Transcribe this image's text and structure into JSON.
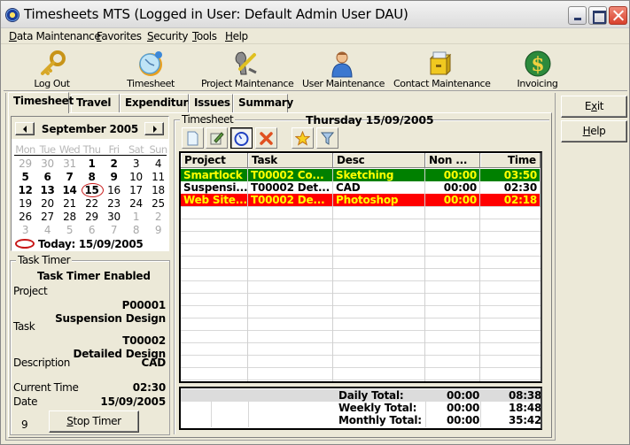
{
  "window": {
    "title": "Timesheets MTS (Logged in User: Default Admin User DAU)",
    "controls": [
      "minimize",
      "maximize",
      "close"
    ]
  },
  "menu": [
    {
      "label": "Data Maintenance",
      "accel": "D"
    },
    {
      "label": "Favorites",
      "accel": "F"
    },
    {
      "label": "Security",
      "accel": "S"
    },
    {
      "label": "Tools",
      "accel": "T"
    },
    {
      "label": "Help",
      "accel": "H"
    }
  ],
  "toolbar": [
    {
      "label": "Log Out",
      "icon": "key-icon"
    },
    {
      "label": "Timesheet",
      "icon": "clock-icon"
    },
    {
      "label": "Project Maintenance",
      "icon": "tools-icon"
    },
    {
      "label": "User Maintenance",
      "icon": "user-icon"
    },
    {
      "label": "Contact Maintenance",
      "icon": "filing-cabinet-icon"
    },
    {
      "label": "Invoicing",
      "icon": "dollar-icon"
    }
  ],
  "tabs": [
    {
      "label": "Timesheet",
      "active": true
    },
    {
      "label": "Travel",
      "active": false
    },
    {
      "label": "Expenditure",
      "active": false
    },
    {
      "label": "Issues",
      "active": false
    },
    {
      "label": "Summary",
      "active": false
    }
  ],
  "calendar": {
    "month_label": "September 2005",
    "weekdays": [
      "Mon",
      "Tue",
      "Wed",
      "Thu",
      "Fri",
      "Sat",
      "Sun"
    ],
    "weeks": [
      [
        {
          "d": "29",
          "o": true
        },
        {
          "d": "30",
          "o": true
        },
        {
          "d": "31",
          "o": true
        },
        {
          "d": "1",
          "b": true
        },
        {
          "d": "2",
          "b": true
        },
        {
          "d": "3"
        },
        {
          "d": "4"
        }
      ],
      [
        {
          "d": "5",
          "b": true
        },
        {
          "d": "6",
          "b": true
        },
        {
          "d": "7",
          "b": true
        },
        {
          "d": "8",
          "b": true
        },
        {
          "d": "9",
          "b": true
        },
        {
          "d": "10"
        },
        {
          "d": "11"
        }
      ],
      [
        {
          "d": "12",
          "b": true
        },
        {
          "d": "13",
          "b": true
        },
        {
          "d": "14",
          "b": true
        },
        {
          "d": "15",
          "b": true,
          "today": true
        },
        {
          "d": "16"
        },
        {
          "d": "17"
        },
        {
          "d": "18"
        }
      ],
      [
        {
          "d": "19"
        },
        {
          "d": "20"
        },
        {
          "d": "21"
        },
        {
          "d": "22"
        },
        {
          "d": "23"
        },
        {
          "d": "24"
        },
        {
          "d": "25"
        }
      ],
      [
        {
          "d": "26"
        },
        {
          "d": "27"
        },
        {
          "d": "28"
        },
        {
          "d": "29"
        },
        {
          "d": "30"
        },
        {
          "d": "1",
          "o": true
        },
        {
          "d": "2",
          "o": true
        }
      ],
      [
        {
          "d": "3",
          "o": true
        },
        {
          "d": "4",
          "o": true
        },
        {
          "d": "5",
          "o": true
        },
        {
          "d": "6",
          "o": true
        },
        {
          "d": "7",
          "o": true
        },
        {
          "d": "8",
          "o": true
        },
        {
          "d": "9",
          "o": true
        }
      ]
    ],
    "today_label": "Today: 15/09/2005"
  },
  "task_timer": {
    "group_label": "Task Timer",
    "status": "Task Timer Enabled",
    "project_label": "Project",
    "project_code": "P00001",
    "project_name": "Suspension Design",
    "task_label": "Task",
    "task_code": "T00002",
    "task_name": "Detailed Design",
    "description_label": "Description",
    "description_value": "CAD",
    "current_time_label": "Current Time",
    "current_time_value": "02:30",
    "date_label": "Date",
    "date_value": "15/09/2005",
    "counter": "9",
    "stop_button": {
      "label": "Stop Timer",
      "accel": "S"
    }
  },
  "timesheet": {
    "group_label": "Timesheet",
    "date_heading": "Thursday 15/09/2005",
    "tools": [
      {
        "name": "new-entry-button",
        "icon": "new-document-icon",
        "pressed": false
      },
      {
        "name": "edit-entry-button",
        "icon": "edit-icon",
        "pressed": false
      },
      {
        "name": "timer-button",
        "icon": "stopwatch-icon",
        "pressed": true
      },
      {
        "name": "delete-entry-button",
        "icon": "delete-x-icon",
        "pressed": false
      },
      {
        "name": "favorite-button",
        "icon": "star-icon",
        "pressed": false
      },
      {
        "name": "filter-button",
        "icon": "filter-icon",
        "pressed": false
      }
    ],
    "columns": [
      "Project",
      "Task",
      "Desc",
      "Non ...",
      "Time"
    ],
    "rows": [
      {
        "project": "Smartlock",
        "task": "T00002 Co...",
        "desc": "Sketching",
        "non": "00:00",
        "time": "03:50",
        "bg": "#008000",
        "fg": "#ffff00"
      },
      {
        "project": "Suspensi...",
        "task": "T00002 Det...",
        "desc": "CAD",
        "non": "00:00",
        "time": "02:30",
        "bg": "#ffffff",
        "fg": "#000000"
      },
      {
        "project": "Web Site...",
        "task": "T00002 De...",
        "desc": "Photoshop",
        "non": "00:00",
        "time": "02:18",
        "bg": "#ff0000",
        "fg": "#ffff00"
      }
    ],
    "totals": [
      {
        "label": "Daily Total:",
        "non": "00:00",
        "time": "08:38"
      },
      {
        "label": "Weekly Total:",
        "non": "00:00",
        "time": "18:48"
      },
      {
        "label": "Monthly Total:",
        "non": "00:00",
        "time": "35:42"
      }
    ]
  },
  "side_buttons": {
    "exit": {
      "label": "Exit",
      "accel": "x"
    },
    "help": {
      "label": "Help",
      "accel": "H"
    }
  }
}
